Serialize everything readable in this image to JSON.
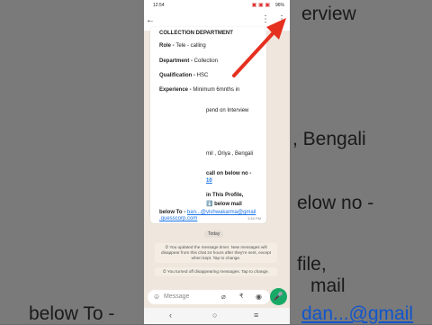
{
  "background_text": {
    "t1": "erview",
    "t2": ", Bengali",
    "t3": "elow no -",
    "t4": "file,",
    "t5": "mail",
    "t6_label": "below To  -",
    "t6_link": "dan...@gmail"
  },
  "status": {
    "time": "12:54",
    "battery": "96%"
  },
  "chat": {
    "lines": {
      "heading": "COLLECTION DEPARTMENT",
      "role_k": "Role - ",
      "role_v": "Tele - calling",
      "dept_k": "Department - ",
      "dept_v": "Collection",
      "qual_k": "Qualification - ",
      "qual_v": "HSC",
      "exp_k": "Experience - ",
      "exp_v": "Minimum 6mnths in",
      "interview": "pend on Interview",
      "lang": "mil , Oriya , Bengali",
      "call": "call on below no -",
      "num": "10",
      "profile": "in This Profile,",
      "belowmail": "⬇️ below mail",
      "belowto_k": "below To  - ",
      "email1": "ban...@vishwakarma@gmail",
      "email2": ".quesscorp.com",
      "time": "3:45 PM"
    },
    "today": "Today",
    "sys1": "⏱ You updated the message timer. New messages will disappear from this chat 24 hours after they're sent, except when kept. Tap to change.",
    "sys2": "⏱ You turned off disappearing messages. Tap to change.",
    "input_placeholder": "Message"
  },
  "colors": {
    "arrow": "#e53020",
    "mic": "#19a967"
  }
}
